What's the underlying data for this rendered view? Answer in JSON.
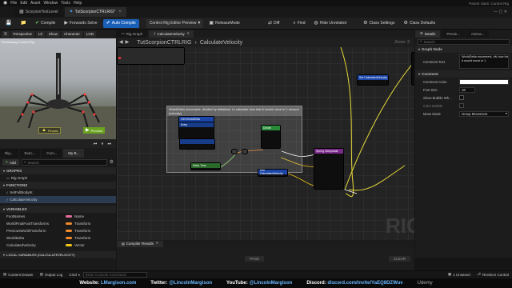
{
  "menu": [
    "File",
    "Edit",
    "Asset",
    "Window",
    "Tools",
    "Help"
  ],
  "window_title": "Parent class: Control Rig",
  "tabs": [
    {
      "label": "ScorpionTestLevel",
      "active": false
    },
    {
      "label": "TutScorpionCTRLRIG*",
      "active": true
    }
  ],
  "toolbar": {
    "compile": "Compile",
    "forwards_solve": "Forwards Solve",
    "auto_compile": "Auto Compile",
    "rig_preview": "Control Rig Editor Preview",
    "release_mode": "ReleaseMode",
    "diff": "Diff",
    "find": "Find",
    "hide_unrelated": "Hide Unrelated",
    "class_settings": "Class Settings",
    "class_defaults": "Class Defaults"
  },
  "viewport": {
    "perspective": "Perspective",
    "lit": "Lit",
    "show": "Show",
    "character": "Character",
    "lod": "LOD",
    "overlay_text": "Previewing Control Rig",
    "pin_btn": "Preview",
    "state_label": "Pinned"
  },
  "left_tabs": [
    "Rig...",
    "Exec...",
    "Curv...",
    "My B..."
  ],
  "add_label": "Add",
  "search_placeholder": "Search",
  "sections": {
    "graphs": "GRAPHS",
    "functions": "FUNCTIONS",
    "variables": "VARIABLES",
    "local_vars": "LOCAL VARIABLES (CALCULATEVELOCITY)"
  },
  "graph_items": [
    "Rig Graph"
  ],
  "function_items": [
    "SetFullBodyIK",
    "CalculateVelocity"
  ],
  "variables": [
    {
      "name": "FootNames",
      "type": "Name",
      "color": "#e26c9a"
    },
    {
      "name": "WorldFinalFootTransforms",
      "type": "Transform",
      "color": "#f08a2a"
    },
    {
      "name": "PreviousWorldTransform",
      "type": "Transform",
      "color": "#f08a2a"
    },
    {
      "name": "WorldDelta",
      "type": "Transform",
      "color": "#f08a2a"
    },
    {
      "name": "CalculatedVelocity",
      "type": "Vector",
      "color": "#f3c516"
    }
  ],
  "graph": {
    "tab1": "Rig Graph",
    "tab2": "CalculateVelocity",
    "breadcrumb_root": "TutScorpionCTRLRIG",
    "breadcrumb_child": "CalculateVelocity",
    "zoom": "Zoom -2",
    "comment_text": "WorldDelta movement, divided by deltatime. to calculate how fast it would move in 1 second (velocity)",
    "watermark": "RIG",
    "node_entry": "Entry",
    "node_return": "Return",
    "node_set_var": "Set CalculatedVelocity",
    "node_get_delta": "Get WorldDelta",
    "node_divide": "Divide",
    "node_delta_time": "Delta Time",
    "node_get_calc": "Get CalculatedVelocity",
    "node_interp": "Spring Interpolate"
  },
  "compiler": {
    "tab": "Compiler Results",
    "page": "PAGE",
    "clear": "CLEAR"
  },
  "details": {
    "tab1": "Details",
    "tab2": "Previe...",
    "tab3": "Anima...",
    "search_placeholder": "Search",
    "section_graph_node": "Graph Node",
    "comment_text_label": "Comment Text",
    "comment_text_value": "WorldDelta movement, div how far it would move in 1",
    "section_comment": "Comment",
    "comment_color_label": "Comment Color",
    "font_size_label": "Font Size",
    "font_size_value": "18",
    "show_bubble_label": "Show Bubble Wh...",
    "color_bubble_label": "Color Bubble",
    "move_mode_label": "Move Mode",
    "move_mode_value": "Group Movement"
  },
  "statusbar": {
    "content_drawer": "Content Drawer",
    "output_log": "Output Log",
    "cmd": "Cmd",
    "cmd_placeholder": "Enter Console Command",
    "unsaved": "1 Unsaved",
    "revision": "Revision Control"
  },
  "footer": {
    "website_label": "Website:",
    "website": "LMargison.com",
    "twitter_label": "Twitter:",
    "twitter": "@LincolnMargison",
    "youtube_label": "YouTube:",
    "youtube": "@LincolnMargison",
    "discord_label": "Discord:",
    "discord": "discord.com/invite/YaEQ8DZWuv",
    "brand": "Udemy"
  }
}
